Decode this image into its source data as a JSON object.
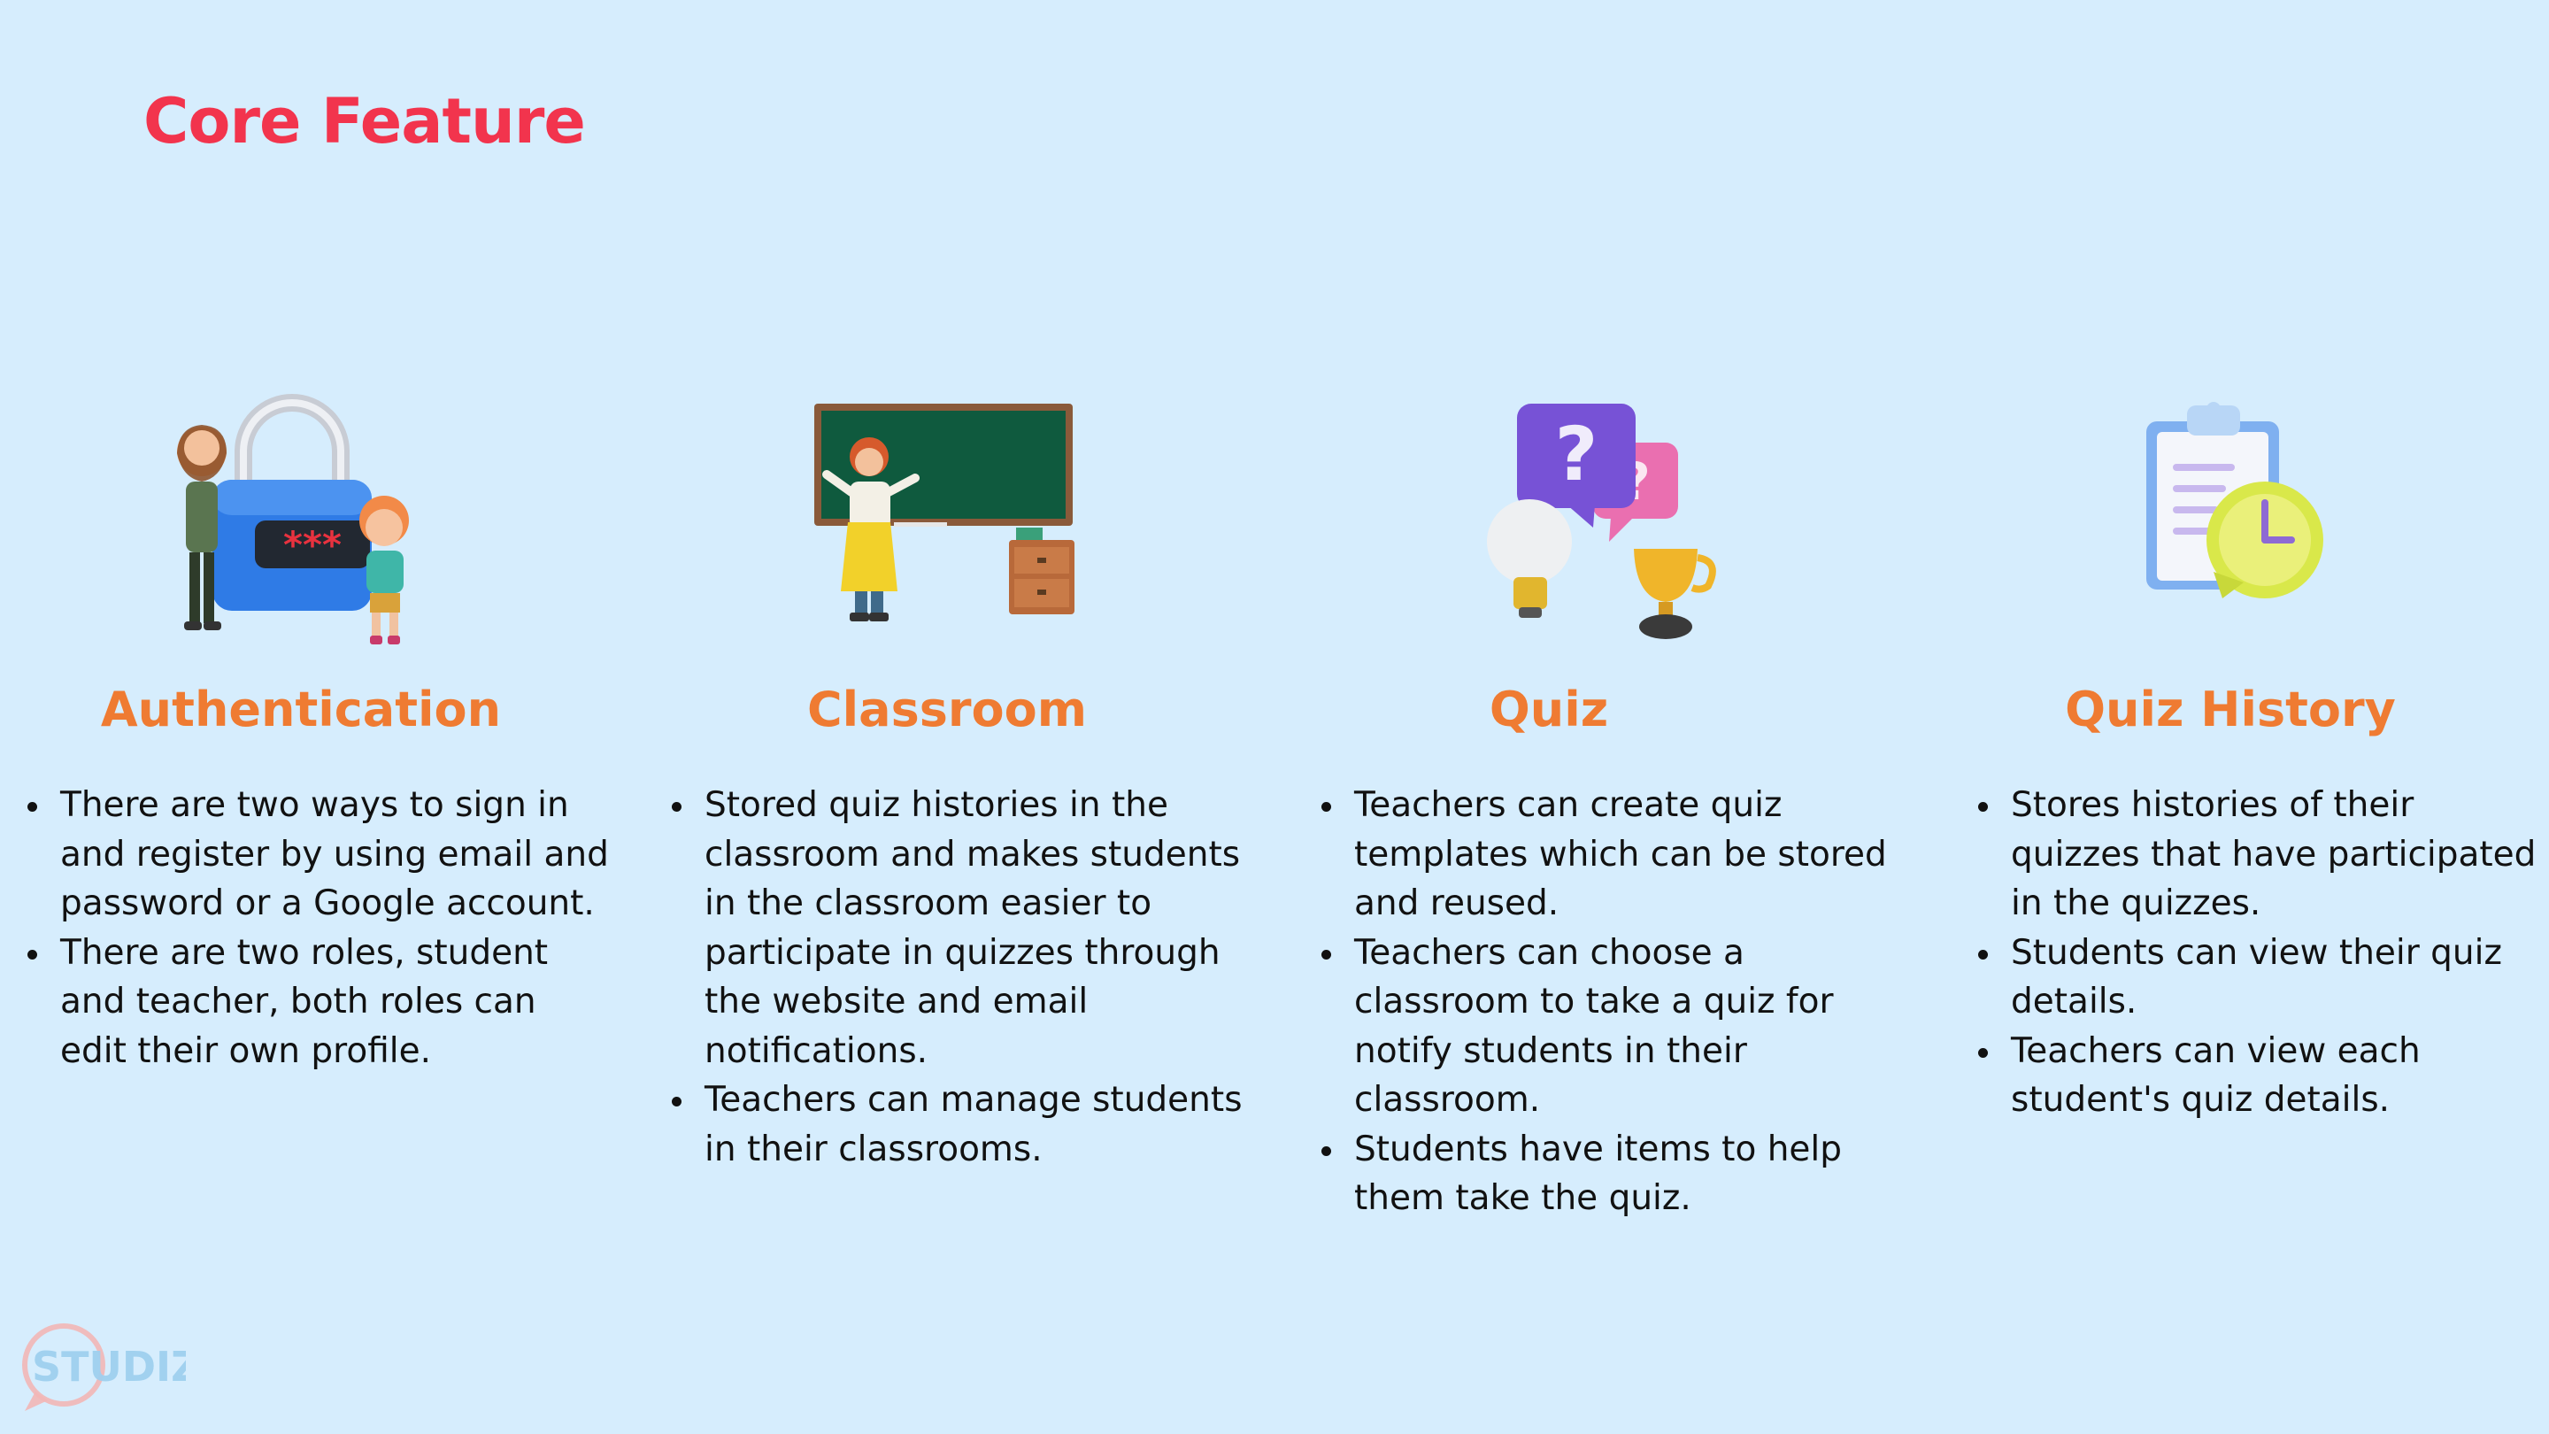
{
  "page": {
    "title": "Core Feature"
  },
  "features": [
    {
      "title": "Authentication",
      "icon": "padlock-password-people-icon",
      "bullets": [
        "There are two ways to sign in and register by using email and password or a Google account.",
        "There are two roles, student and teacher, both roles can edit their own profile."
      ]
    },
    {
      "title": "Classroom",
      "icon": "teacher-chalkboard-icon",
      "bullets": [
        "Stored quiz histories in the classroom and makes students in the classroom easier to participate in quizzes through the website and email notifications.",
        "Teachers can manage students in their classrooms."
      ]
    },
    {
      "title": "Quiz",
      "icon": "question-bubbles-bulb-trophy-icon",
      "bullets": [
        "Teachers can create quiz templates which can be stored and reused.",
        "Teachers can choose a classroom to take a quiz for notify students in their classroom.",
        "Students have items to help them take the quiz."
      ]
    },
    {
      "title": "Quiz History",
      "icon": "clipboard-clock-icon",
      "bullets": [
        "Stores histories of their quizzes that have participated in the quizzes.",
        "Students can view their quiz details.",
        "Teachers can view each student's quiz details."
      ]
    }
  ],
  "logo": {
    "text": "STUDIZ",
    "password_mask": "***"
  },
  "colors": {
    "background": "#d6edfd",
    "title": "#f2344d",
    "heading": "#ef7b32"
  }
}
